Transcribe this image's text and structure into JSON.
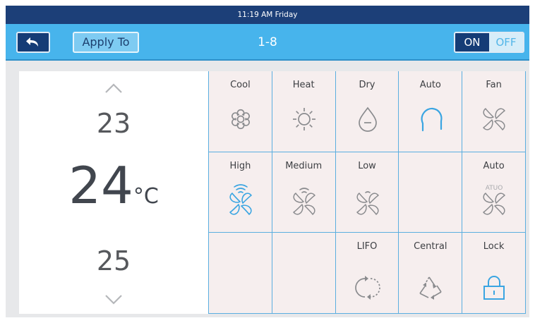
{
  "status_bar": {
    "time_text": "11:19 AM  Friday"
  },
  "header": {
    "apply_label": "Apply To",
    "unit_title": "1-8",
    "power": {
      "on_label": "ON",
      "off_label": "OFF",
      "state": "on"
    }
  },
  "temperature": {
    "above": "23",
    "current": "24",
    "unit": "°C",
    "below": "25"
  },
  "modes": [
    {
      "label": "Cool",
      "icon": "snowflake-icon",
      "selected": false
    },
    {
      "label": "Heat",
      "icon": "sun-icon",
      "selected": false
    },
    {
      "label": "Dry",
      "icon": "droplet-icon",
      "selected": false
    },
    {
      "label": "Auto",
      "icon": "auto-mode-icon",
      "selected": true
    },
    {
      "label": "Fan",
      "icon": "fan-icon",
      "selected": false
    }
  ],
  "fan_speeds": [
    {
      "label": "High",
      "icon": "fan-high-icon",
      "selected": true
    },
    {
      "label": "Medium",
      "icon": "fan-medium-icon",
      "selected": false
    },
    {
      "label": "Low",
      "icon": "fan-low-icon",
      "selected": false
    },
    {
      "label": "Auto",
      "icon": "fan-auto-icon",
      "icon_text": "ATUO",
      "selected": false
    }
  ],
  "functions": [
    {
      "label": "LIFO",
      "icon": "swing-icon"
    },
    {
      "label": "Central",
      "icon": "central-icon"
    },
    {
      "label": "Lock",
      "icon": "lock-icon"
    }
  ],
  "colors": {
    "selected": "#3aa5e2",
    "unselected": "#8a8b8e",
    "header": "#47b4ec",
    "status_bar": "#1c3f78"
  }
}
